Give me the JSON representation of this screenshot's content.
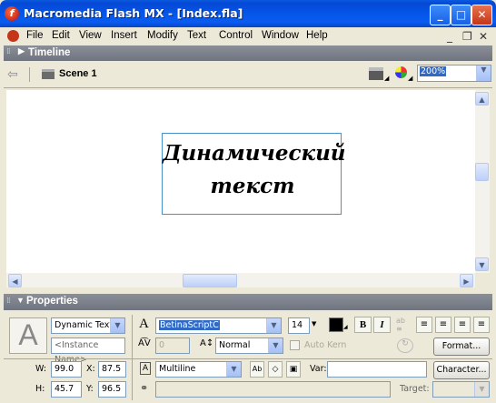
{
  "window": {
    "title": "Macromedia Flash MX - [Index.fla]",
    "app_icon_glyph": "f",
    "minimize_glyph": "_",
    "maximize_glyph": "□",
    "close_glyph": "✕"
  },
  "menu": {
    "items": [
      "File",
      "Edit",
      "View",
      "Insert",
      "Modify",
      "Text",
      "Control",
      "Window",
      "Help"
    ],
    "mdi": {
      "minimize": "_",
      "restore": "❐",
      "close": "✕"
    }
  },
  "timeline": {
    "title": "Timeline"
  },
  "scene": {
    "back_glyph": "⇦",
    "name": "Scene 1",
    "zoom": "200%"
  },
  "stage": {
    "text": "Динамический\nтекст"
  },
  "properties": {
    "title": "Properties",
    "text_type": "Dynamic Text",
    "instance_name_placeholder": "<Instance Name>",
    "font": "BetinaScriptC",
    "font_size": "14",
    "kerning_value": "0",
    "position": "Normal",
    "auto_kern_label": "Auto Kern",
    "format_button": "Format...",
    "W_label": "W:",
    "W": "99.0",
    "X_label": "X:",
    "X": "87.5",
    "H_label": "H:",
    "H": "45.7",
    "Y_label": "Y:",
    "Y": "96.5",
    "line_type": "Multiline",
    "var_label": "Var:",
    "character_button": "Character...",
    "target_label": "Target:",
    "bold_glyph": "B",
    "italic_glyph": "I",
    "text_icon_glyph": "A"
  },
  "colors": {
    "title_bar": "#0454e8",
    "panel_header": "#7c818a",
    "selection": "#316ac5",
    "text_box_border": "#4a90c8"
  }
}
